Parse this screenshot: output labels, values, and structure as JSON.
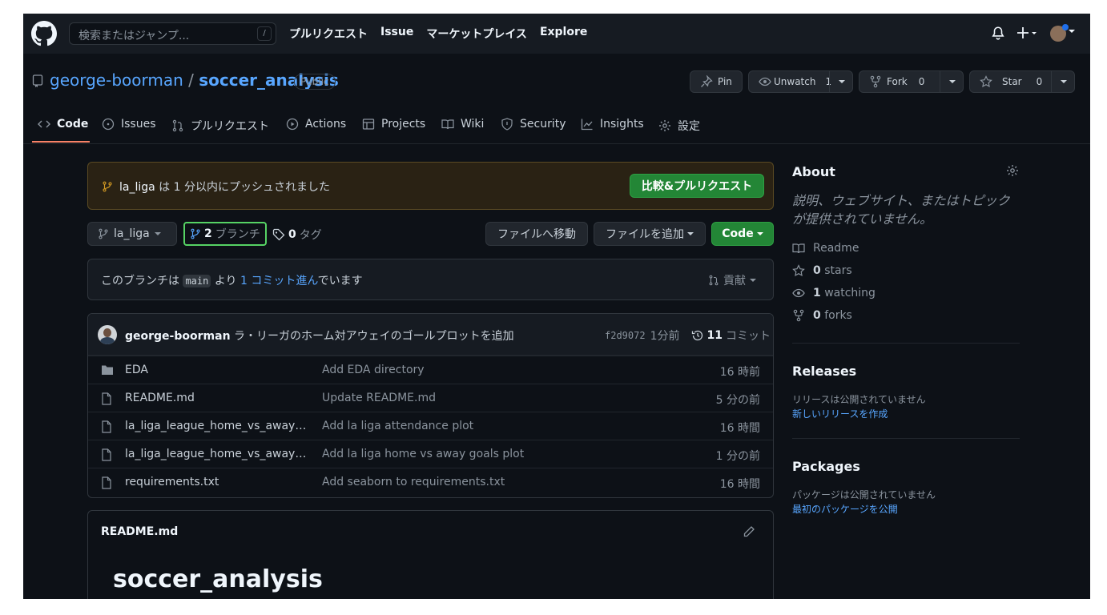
{
  "header": {
    "search_placeholder": "検索またはジャンプ...",
    "search_shortcut": "/",
    "nav": [
      "プルリクエスト",
      "Issue",
      "マーケットプレイス",
      "Explore"
    ]
  },
  "repo": {
    "owner": "george-boorman",
    "separator": "/",
    "name": "soccer_analysis",
    "visibility": "Public",
    "pin_label": "Pin",
    "watch_label": "Unwatch",
    "watch_count": "1",
    "fork_label": "Fork",
    "fork_count": "0",
    "star_label": "Star",
    "star_count": "0"
  },
  "tabs": [
    {
      "label": "Code",
      "icon": "code-icon"
    },
    {
      "label": "Issues",
      "icon": "issue-opened-icon"
    },
    {
      "label": "プルリクエスト",
      "icon": "git-pull-request-icon"
    },
    {
      "label": "Actions",
      "icon": "play-icon"
    },
    {
      "label": "Projects",
      "icon": "table-icon"
    },
    {
      "label": "Wiki",
      "icon": "book-icon"
    },
    {
      "label": "Security",
      "icon": "shield-icon"
    },
    {
      "label": "Insights",
      "icon": "graph-icon"
    },
    {
      "label": "設定",
      "icon": "gear-icon"
    }
  ],
  "banner": {
    "branch": "la_liga",
    "text": " は 1 分以内にプッシュされました",
    "button": "比較&プルリクエスト"
  },
  "branch_bar": {
    "current_branch": "la_liga",
    "branch_count": "2",
    "branch_label": "ブランチ",
    "tag_count": "0",
    "tag_label": "タグ",
    "goto_file": "ファイルへ移動",
    "add_file": "ファイルを追加",
    "code_button": "Code"
  },
  "ahead": {
    "prefix": "このブランチは ",
    "base": "main",
    "middle": " より ",
    "link": "1 コミット進ん",
    "suffix": "でいます",
    "contribute": "貢献"
  },
  "latest_commit": {
    "author": "george-boorman",
    "message": "ラ・リーガのホーム対アウェイのゴールプロットを追加",
    "sha": "f2d9072",
    "time": "1分前",
    "commit_count": "11",
    "commit_label": "コミット"
  },
  "files": [
    {
      "type": "dir",
      "name": "EDA",
      "message": "Add EDA directory",
      "time": "16 時前"
    },
    {
      "type": "file",
      "name": "README.md",
      "message": "Update README.md",
      "time": "5 分の前"
    },
    {
      "type": "file",
      "name": "la_liga_league_home_vs_away_attendance_plot.py",
      "message": "Add la liga attendance plot",
      "time": "16 時間"
    },
    {
      "type": "file",
      "name": "la_liga_league_home_vs_away_goals_plot.py",
      "message": "Add la liga home vs away goals plot",
      "time": "1 分の前"
    },
    {
      "type": "file",
      "name": "requirements.txt",
      "message": "Add seaborn to requirements.txt",
      "time": "16 時間"
    }
  ],
  "readme": {
    "filename": "README.md",
    "heading": "soccer_analysis"
  },
  "about": {
    "title": "About",
    "description": "説明、ウェブサイト、またはトピックが提供されていません。",
    "readme": "Readme",
    "stars_count": "0",
    "stars_label": "stars",
    "watching_count": "1",
    "watching_label": "watching",
    "forks_count": "0",
    "forks_label": "forks"
  },
  "releases": {
    "title": "Releases",
    "empty": "リリースは公開されていません",
    "link": "新しいリリースを作成"
  },
  "packages": {
    "title": "Packages",
    "empty": "パッケージは公開されていません",
    "link": "最初のパッケージを公開"
  },
  "colors": {
    "accent": "#58a6ff",
    "green": "#238636",
    "tab_underline": "#f78166",
    "banner_bg": "#2a2214"
  }
}
